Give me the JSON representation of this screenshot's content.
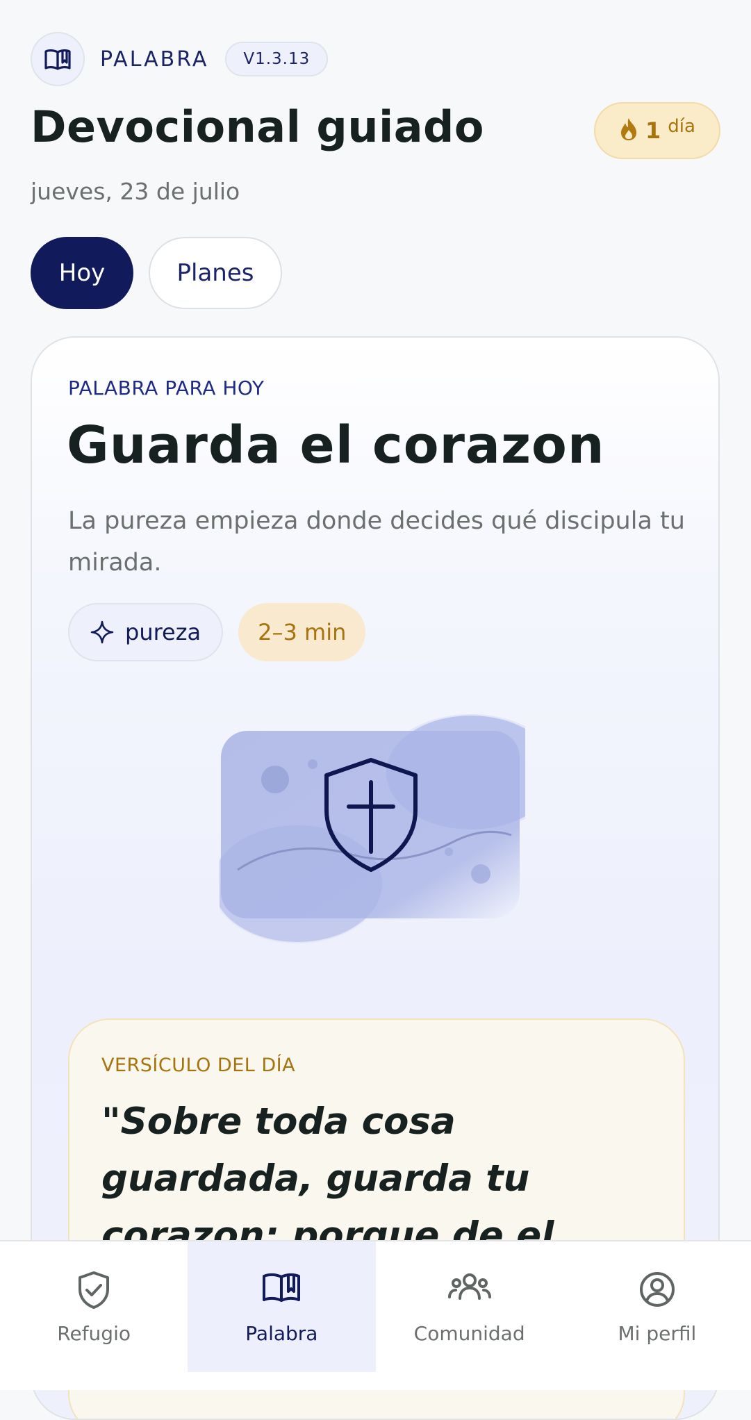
{
  "app": {
    "brand_name": "PALABRA",
    "version": "V1.3.13",
    "brand_icon": "book-open-icon"
  },
  "header": {
    "title": "Devocional guiado",
    "date": "jueves, 23 de julio",
    "streak": {
      "count": "1",
      "unit": "día",
      "icon": "flame-icon",
      "color": "#a8730d"
    }
  },
  "tabs": [
    {
      "label": "Hoy",
      "active": true
    },
    {
      "label": "Planes",
      "active": false
    }
  ],
  "devotional": {
    "eyebrow": "PALABRA PARA HOY",
    "title": "Guarda el corazon",
    "subtitle": "La pureza empieza donde decides qué discipula tu mirada.",
    "tags": {
      "topic": {
        "label": "pureza",
        "icon": "sparkle-icon"
      },
      "duration": "2–3 min"
    },
    "illustration_icon": "shield-cross-icon",
    "verse": {
      "eyebrow": "VERSÍCULO DEL DÍA",
      "text": "\"Sobre toda cosa guardada, guarda tu corazon; porque de el mana la vida.\""
    }
  },
  "bottom_nav": [
    {
      "label": "Refugio",
      "icon": "shield-check-icon",
      "active": false
    },
    {
      "label": "Palabra",
      "icon": "book-open-icon",
      "active": true
    },
    {
      "label": "Comunidad",
      "icon": "users-icon",
      "active": false
    },
    {
      "label": "Mi perfil",
      "icon": "user-circle-icon",
      "active": false
    }
  ],
  "colors": {
    "primary_navy": "#111a5a",
    "accent_gold": "#a8730d",
    "background": "#f7f8fa"
  }
}
